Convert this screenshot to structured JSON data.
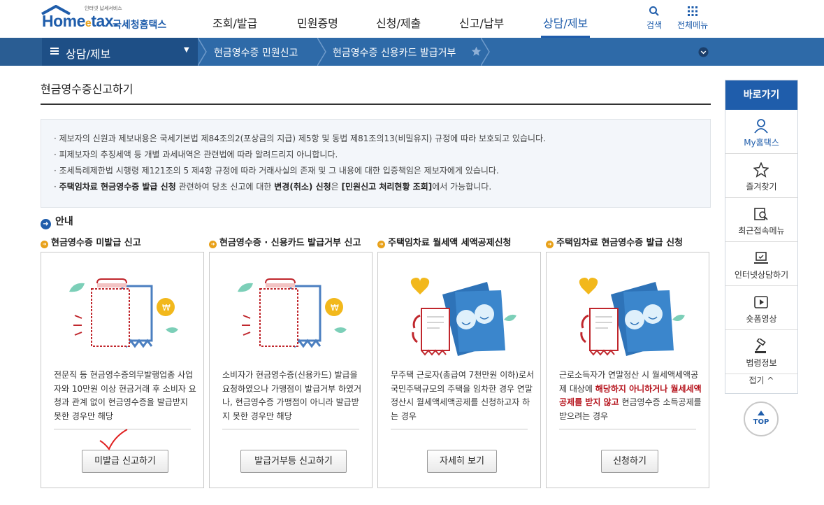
{
  "header": {
    "logo_tag": "인터넷 납세서비스",
    "logo_word": "Home",
    "logo_word_e": "e",
    "logo_word_end": "tax.",
    "logo_kr": "국세청홈택스",
    "nav": [
      "조회/발급",
      "민원증명",
      "신청/제출",
      "신고/납부",
      "상담/제보"
    ],
    "active_nav": "상담/제보",
    "search_label": "검색",
    "allmenu_label": "전체메뉴"
  },
  "breadcrumb": {
    "menu_label": "상담/제보",
    "items": [
      "현금영수증 민원신고",
      "현금영수증 신용카드 발급거부"
    ]
  },
  "page": {
    "title": "현금영수증신고하기"
  },
  "notice": {
    "line1": "제보자의 신원과 제보내용은 국세기본법 제84조의2(포상금의 지급) 제5항 및 동법 제81조의13(비밀유지) 규정에 따라 보호되고 있습니다.",
    "line2": "피제보자의 추징세액 등 개별 과세내역은 관련법에 따라 알려드리지 아니합니다.",
    "line3": "조세특례제한법 시행령 제121조의 5 제4항 규정에 따라 거래사실의 존재 및 그 내용에 대한 입증책임은 제보자에게 있습니다.",
    "line4_b1": "주택임차료 현금영수증 발급 신청",
    "line4_t1": " 관련하여 당초 신고에 대한 ",
    "line4_b2": "변경(취소) 신청",
    "line4_t2": "은 ",
    "line4_b3": "[민원신고 처리현황 조회]",
    "line4_t3": "에서 가능합니다."
  },
  "guide": {
    "label": "안내"
  },
  "cards": [
    {
      "section_title": "현금영수증 미발급 신고",
      "desc": "전문직 등 현금영수증의무발행업종 사업자와 10만원 이상 현금거래 후 소비자 요청과 관계 없이 현금영수증을 발급받지 못한 경우만 해당",
      "button": "미발급 신고하기"
    },
    {
      "section_title": "현금영수증 · 신용카드 발급거부 신고",
      "desc": "소비자가 현금영수증(신용카드) 발급을 요청하였으나 가맹점이 발급거부 하였거나, 현금영수증 가맹점이 아니라 발급받지 못한 경우만 해당",
      "button": "발급거부등 신고하기"
    },
    {
      "section_title": "주택임차료 월세액 세액공제신청",
      "desc": "무주택 근로자(총급여 7천만원 이하)로서 국민주택규모의 주택을 임차한 경우 연말정산시 월세액세액공제를 신청하고자 하는 경우",
      "button": "자세히 보기"
    },
    {
      "section_title": "주택임차료 현금영수증 발급 신청",
      "desc_a": "근로소득자가 연말정산 시 월세액세액공제 대상에 ",
      "desc_red": "해당하지 아니하거나 월세세액공제를 받지 않고",
      "desc_b": " 현금영수증 소득공제를 받으려는 경우",
      "button": "신청하기"
    }
  ],
  "quick": {
    "title": "바로가기",
    "items": [
      "My홈택스",
      "즐겨찾기",
      "최근접속메뉴",
      "인터넷상담하기",
      "숏폼영상",
      "법령정보"
    ],
    "fold": "접기 ^",
    "top": "TOP"
  },
  "colors": {
    "brand_blue": "#1f5dab",
    "bar_blue": "#2e6aa8",
    "accent_orange": "#e8a11a",
    "alert_red": "#b5121b"
  }
}
